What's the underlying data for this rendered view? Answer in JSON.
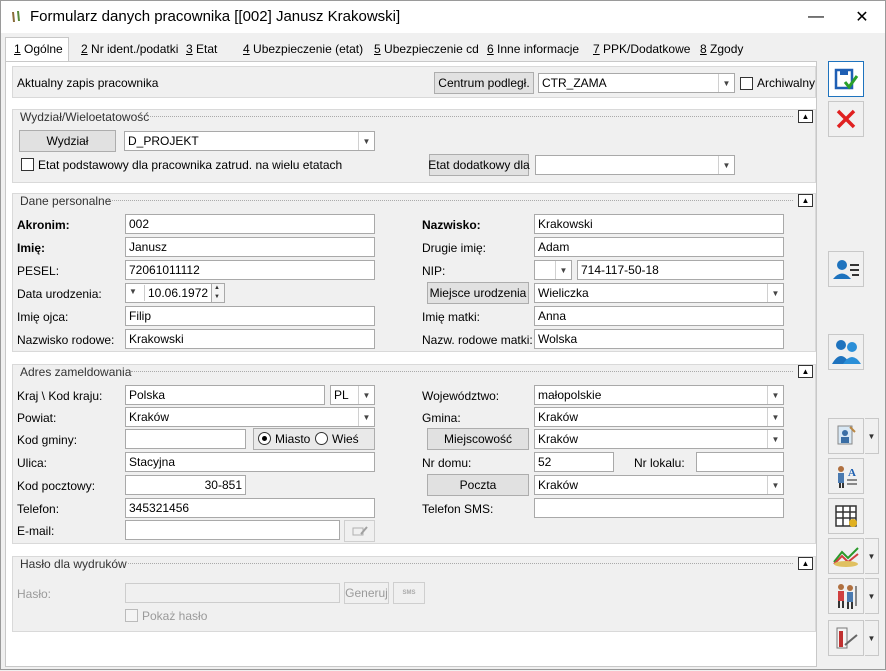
{
  "window": {
    "title": "Formularz danych pracownika [[002] Janusz Krakowski]",
    "minimize": "—",
    "close": "✕"
  },
  "tabs": [
    {
      "key": "1",
      "label": " Ogólne"
    },
    {
      "key": "2",
      "label": " Nr ident./podatki"
    },
    {
      "key": "3",
      "label": " Etat"
    },
    {
      "key": "4",
      "label": " Ubezpieczenie (etat)"
    },
    {
      "key": "5",
      "label": " Ubezpieczenie cd"
    },
    {
      "key": "6",
      "label": " Inne informacje"
    },
    {
      "key": "7",
      "label": " PPK/Dodatkowe"
    },
    {
      "key": "8",
      "label": " Zgody"
    }
  ],
  "top": {
    "label": "Aktualny zapis pracownika",
    "centrum_button": "Centrum podległ.",
    "centrum_value": "CTR_ZAMA",
    "archiwalny": "Archiwalny"
  },
  "wydzial": {
    "section_title": "Wydział/Wieloetatowość",
    "wydzial_button": "Wydział",
    "wydzial_value": "D_PROJEKT",
    "etat_checkbox": "Etat podstawowy dla pracownika zatrud. na wielu etatach",
    "etat_dod_button": "Etat dodatkowy dla",
    "etat_dod_value": ""
  },
  "personal": {
    "section_title": "Dane personalne",
    "akronim_label": "Akronim:",
    "akronim": "002",
    "imie_label": "Imię:",
    "imie": "Janusz",
    "pesel_label": "PESEL:",
    "pesel": "72061011112",
    "data_ur_label": "Data urodzenia:",
    "data_ur": "10.06.1972",
    "imie_ojca_label": "Imię ojca:",
    "imie_ojca": "Filip",
    "nazwisko_rodowe_label": "Nazwisko rodowe:",
    "nazwisko_rodowe": "Krakowski",
    "nazwisko_label": "Nazwisko:",
    "nazwisko": "Krakowski",
    "drugie_imie_label": "Drugie imię:",
    "drugie_imie": "Adam",
    "nip_label": "NIP:",
    "nip_prefix": "",
    "nip": "714-117-50-18",
    "miejsce_ur_button": "Miejsce urodzenia",
    "miejsce_ur": "Wieliczka",
    "imie_matki_label": "Imię matki:",
    "imie_matki": "Anna",
    "nazw_rod_matki_label": "Nazw. rodowe matki:",
    "nazw_rod_matki": "Wolska"
  },
  "address": {
    "section_title": "Adres zameldowania",
    "kraj_label": "Kraj \\ Kod kraju:",
    "kraj": "Polska",
    "kod_kraju": "PL",
    "powiat_label": "Powiat:",
    "powiat": "Kraków",
    "kod_gminy_label": "Kod gminy:",
    "kod_gminy": "",
    "miasto": "Miasto",
    "wies": "Wieś",
    "ulica_label": "Ulica:",
    "ulica": "Stacyjna",
    "kod_pocztowy_label": "Kod pocztowy:",
    "kod_pocztowy": "30-851",
    "telefon_label": "Telefon:",
    "telefon": "345321456",
    "email_label": "E-mail:",
    "email": "",
    "wojewodztwo_label": "Województwo:",
    "wojewodztwo": "małopolskie",
    "gmina_label": "Gmina:",
    "gmina": "Kraków",
    "miejscowosc_button": "Miejscowość",
    "miejscowosc": "Kraków",
    "nr_domu_label": "Nr domu:",
    "nr_domu": "52",
    "nr_lokalu_label": "Nr lokalu:",
    "nr_lokalu": "",
    "poczta_button": "Poczta",
    "poczta": "Kraków",
    "telefon_sms_label": "Telefon SMS:",
    "telefon_sms": ""
  },
  "password": {
    "section_title": "Hasło dla wydruków",
    "haslo_label": "Hasło:",
    "haslo": "",
    "generuj": "Generuj",
    "sms": "SMS",
    "pokaz_haslo": "Pokaż hasło"
  },
  "colors": {
    "save_blue": "#1f5fb4",
    "cancel_red": "#e02020",
    "accent_blue": "#1e73be"
  }
}
